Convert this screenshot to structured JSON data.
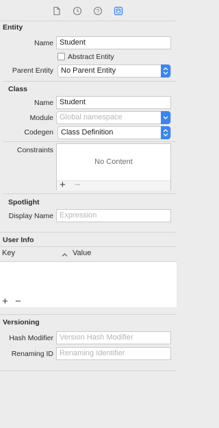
{
  "toolbar": {
    "icons": [
      "file-inspector-icon",
      "history-inspector-icon",
      "quick-help-icon",
      "data-model-inspector-icon"
    ],
    "active": "data-model-inspector-icon",
    "accent": "#3a84f5"
  },
  "entity": {
    "header": "Entity",
    "name_label": "Name",
    "name_value": "Student",
    "abstract_label": "Abstract Entity",
    "abstract_checked": false,
    "parent_label": "Parent Entity",
    "parent_value": "No Parent Entity"
  },
  "class": {
    "header": "Class",
    "name_label": "Name",
    "name_value": "Student",
    "module_label": "Module",
    "module_placeholder": "Global namespace",
    "codegen_label": "Codegen",
    "codegen_value": "Class Definition"
  },
  "constraints": {
    "label": "Constraints",
    "empty_text": "No Content",
    "add": "+",
    "remove": "−"
  },
  "spotlight": {
    "header": "Spotlight",
    "display_name_label": "Display Name",
    "display_name_placeholder": "Expression"
  },
  "user_info": {
    "header": "User Info",
    "col_key": "Key",
    "col_value": "Value",
    "add": "+",
    "remove": "−"
  },
  "versioning": {
    "header": "Versioning",
    "hash_label": "Hash Modifier",
    "hash_placeholder": "Version Hash Modifier",
    "renaming_label": "Renaming ID",
    "renaming_placeholder": "Renaming Identifier"
  }
}
